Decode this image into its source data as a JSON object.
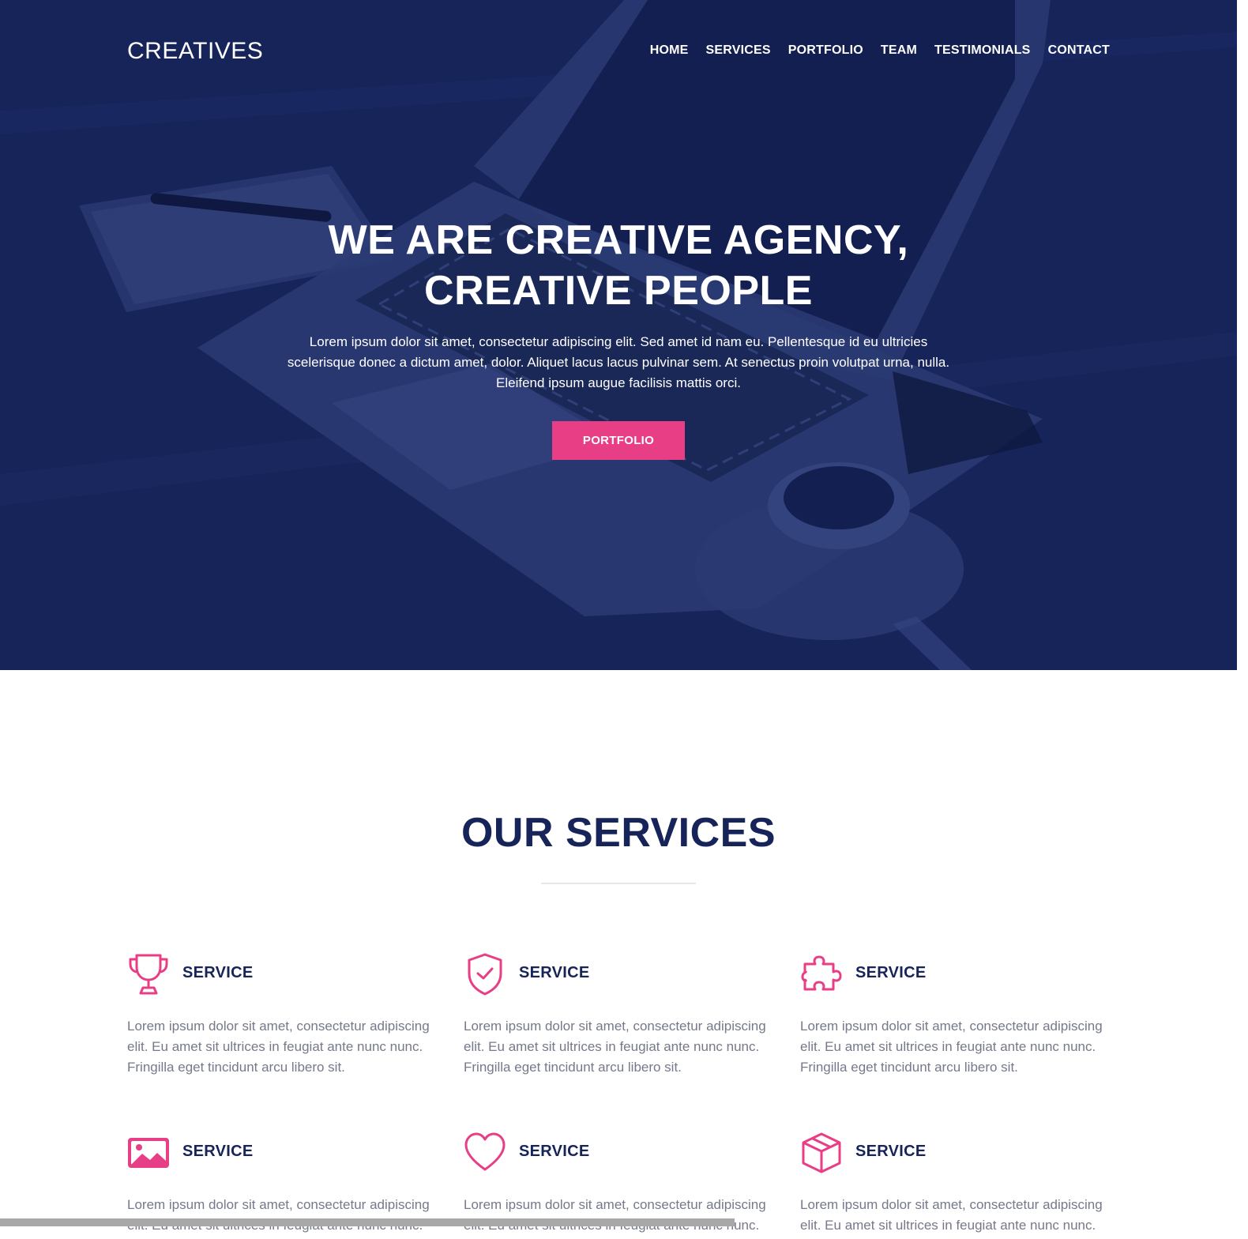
{
  "colors": {
    "hero_overlay": "#16245a",
    "accent": "#e83e86",
    "heading": "#16245a",
    "body_text": "#75798a"
  },
  "header": {
    "brand": "CREATIVES",
    "nav": [
      "HOME",
      "SERVICES",
      "PORTFOLIO",
      "TEAM",
      "TESTIMONIALS",
      "CONTACT"
    ]
  },
  "hero": {
    "title_line1": "WE ARE CREATIVE AGENCY,",
    "title_line2": "CREATIVE PEOPLE",
    "text": "Lorem ipsum dolor sit amet, consectetur adipiscing elit. Sed amet id nam eu. Pellentesque id eu ultricies scelerisque donec a dictum amet, dolor. Aliquet lacus lacus pulvinar sem. At senectus proin volutpat urna, nulla. Eleifend ipsum augue facilisis mattis orci.",
    "button": "PORTFOLIO"
  },
  "services": {
    "title": "OUR SERVICES",
    "items": [
      {
        "icon": "trophy-icon",
        "title": "SERVICE",
        "text": "Lorem ipsum dolor sit amet, consectetur adipiscing elit. Eu amet sit ultrices in feugiat ante nunc nunc. Fringilla eget tincidunt arcu libero sit."
      },
      {
        "icon": "shield-check-icon",
        "title": "SERVICE",
        "text": "Lorem ipsum dolor sit amet, consectetur adipiscing elit. Eu amet sit ultrices in feugiat ante nunc nunc. Fringilla eget tincidunt arcu libero sit."
      },
      {
        "icon": "puzzle-icon",
        "title": "SERVICE",
        "text": "Lorem ipsum dolor sit amet, consectetur adipiscing elit. Eu amet sit ultrices in feugiat ante nunc nunc. Fringilla eget tincidunt arcu libero sit."
      },
      {
        "icon": "image-icon",
        "title": "SERVICE",
        "text": "Lorem ipsum dolor sit amet, consectetur adipiscing elit. Eu amet sit ultrices in feugiat ante nunc nunc."
      },
      {
        "icon": "heart-icon",
        "title": "SERVICE",
        "text": "Lorem ipsum dolor sit amet, consectetur adipiscing elit. Eu amet sit ultrices in feugiat ante nunc nunc."
      },
      {
        "icon": "box-icon",
        "title": "SERVICE",
        "text": "Lorem ipsum dolor sit amet, consectetur adipiscing elit. Eu amet sit ultrices in feugiat ante nunc nunc."
      }
    ]
  }
}
